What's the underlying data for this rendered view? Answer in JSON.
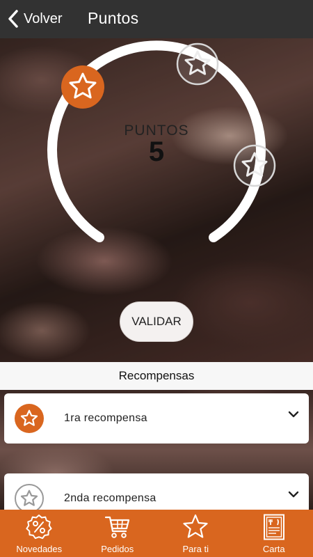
{
  "header": {
    "back_label": "Volver",
    "title": "Puntos"
  },
  "points": {
    "label": "PUNTOS",
    "value": "5",
    "max_points": 15,
    "progress_fraction": 0.0
  },
  "validate_label": "VALIDAR",
  "rewards": {
    "title": "Recompensas",
    "items": [
      {
        "label": "1ra recompensa",
        "unlocked": true
      },
      {
        "label": "2nda recompensa",
        "unlocked": false
      }
    ]
  },
  "tabs": [
    {
      "label": "Novedades",
      "icon": "percent-badge-icon"
    },
    {
      "label": "Pedidos",
      "icon": "shopping-cart-icon"
    },
    {
      "label": "Para ti",
      "icon": "star-icon"
    },
    {
      "label": "Carta",
      "icon": "menu-card-icon"
    }
  ],
  "colors": {
    "accent": "#d9661f",
    "header_bg": "#323232"
  }
}
